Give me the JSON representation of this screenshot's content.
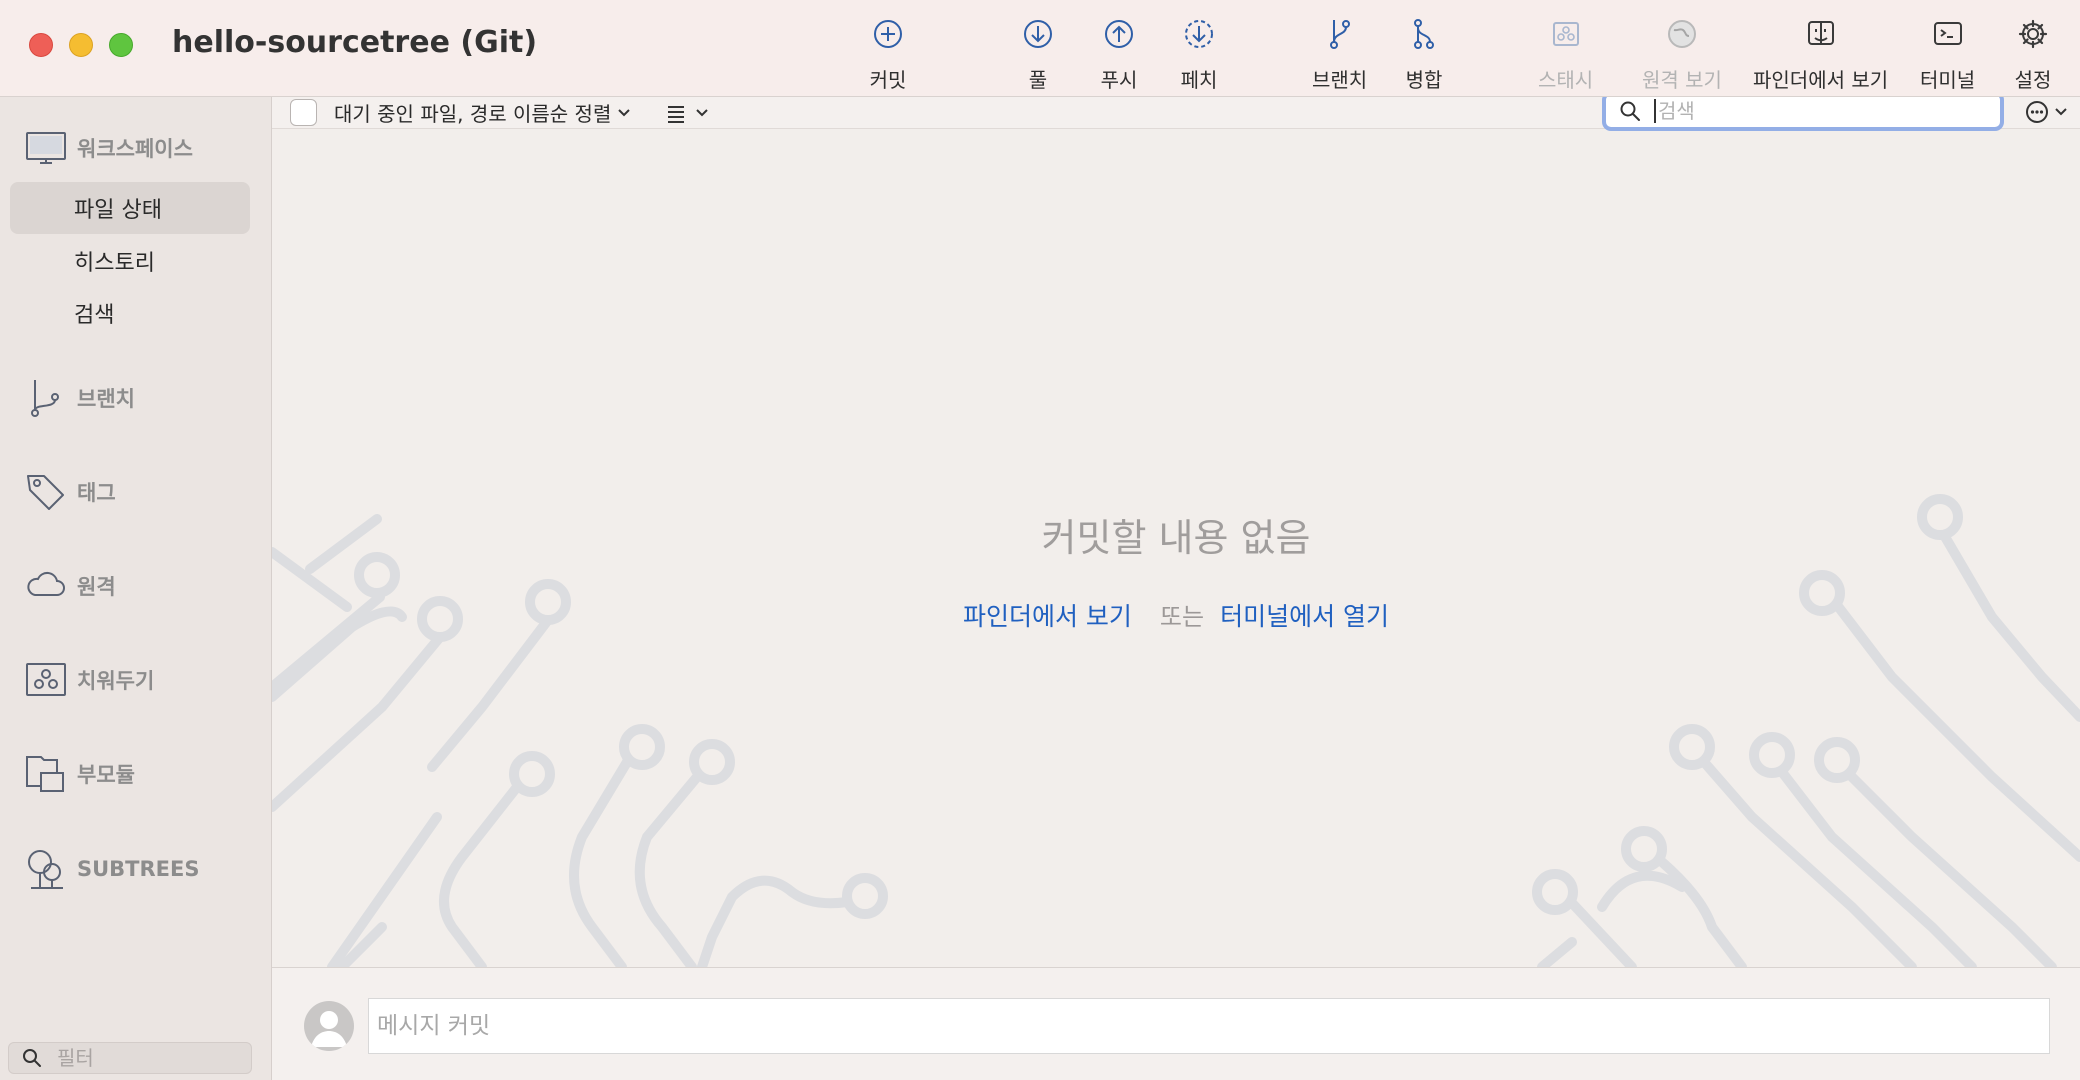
{
  "window": {
    "title": "hello-sourcetree (Git)"
  },
  "toolbar": {
    "commit": "커밋",
    "pull": "풀",
    "push": "푸시",
    "fetch": "페치",
    "branch": "브랜치",
    "merge": "병합",
    "stash": "스태시",
    "remote_view": "원격 보기",
    "finder_view": "파인더에서 보기",
    "terminal": "터미널",
    "settings": "설정"
  },
  "sidebar": {
    "workspace": "워크스페이스",
    "items": [
      {
        "label": "파일 상태",
        "selected": true
      },
      {
        "label": "히스토리",
        "selected": false
      },
      {
        "label": "검색",
        "selected": false
      }
    ],
    "branches": "브랜치",
    "tags": "태그",
    "remotes": "원격",
    "stashes": "치워두기",
    "submodules": "부모듈",
    "subtrees": "SUBTREES",
    "filter_placeholder": "필터"
  },
  "subbar": {
    "sort_label": "대기 중인 파일, 경로 이름순 정렬",
    "search_placeholder": "검색"
  },
  "main": {
    "empty_title": "커밋할 내용 없음",
    "finder_link": "파인더에서 보기",
    "or_text": "또는",
    "terminal_link": "터미널에서 열기"
  },
  "commit": {
    "placeholder": "메시지 커밋"
  },
  "colors": {
    "accent_link": "#2060c0",
    "toolbar_icon": "#2f5fa8",
    "search_focus": "#93aee6"
  }
}
